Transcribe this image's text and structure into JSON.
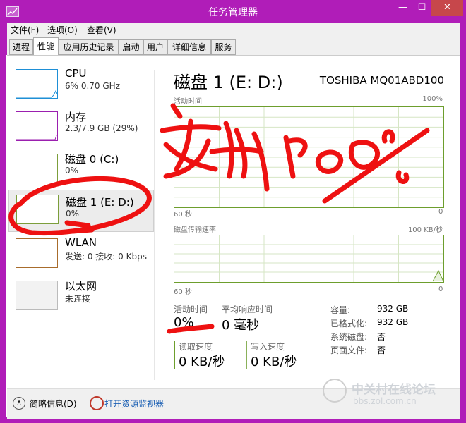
{
  "window": {
    "title": "任务管理器",
    "min": "—",
    "max": "☐",
    "close": "✕"
  },
  "menu": [
    "文件(F)",
    "选项(O)",
    "查看(V)"
  ],
  "tabs": [
    "进程",
    "性能",
    "应用历史记录",
    "启动",
    "用户",
    "详细信息",
    "服务"
  ],
  "active_tab": 1,
  "sidebar": [
    {
      "name": "CPU",
      "sub": "6% 0.70 GHz",
      "color": "#1e8fd6"
    },
    {
      "name": "内存",
      "sub": "2.3/7.9 GB (29%)",
      "color": "#9b1faf"
    },
    {
      "name": "磁盘 0 (C:)",
      "sub": "0%",
      "color": "#6d9e2d"
    },
    {
      "name": "磁盘 1 (E: D:)",
      "sub": "0%",
      "color": "#6d9e2d"
    },
    {
      "name": "WLAN",
      "sub": "发送: 0 接收: 0 Kbps",
      "color": "#a86c2c"
    },
    {
      "name": "以太网",
      "sub": "未连接",
      "color": "#aaaaaa"
    }
  ],
  "header": {
    "title": "磁盘 1 (E: D:)",
    "model": "TOSHIBA MQ01ABD100"
  },
  "graph1": {
    "label": "活动时间",
    "max": "100%",
    "left": "60 秒",
    "right": "0",
    "value_percent": 0
  },
  "graph2": {
    "label": "磁盘传输速率",
    "max": "100 KB/秒",
    "left": "60 秒",
    "right": "0"
  },
  "stats": {
    "active_label": "活动时间",
    "active_value": "0%",
    "resp_label": "平均响应时间",
    "resp_value": "0 毫秒",
    "read_label": "读取速度",
    "read_value": "0 KB/秒",
    "write_label": "写入速度",
    "write_value": "0 KB/秒"
  },
  "props": [
    {
      "label": "容量:",
      "value": "932 GB"
    },
    {
      "label": "已格式化:",
      "value": "932 GB"
    },
    {
      "label": "系统磁盘:",
      "value": "否"
    },
    {
      "label": "页面文件:",
      "value": "否"
    }
  ],
  "footer": {
    "less": "简略信息(D)",
    "monitor": "打开资源监视器"
  },
  "watermark": {
    "cn": "中关村在线论坛",
    "url": "bbs.zol.com.cn"
  }
}
